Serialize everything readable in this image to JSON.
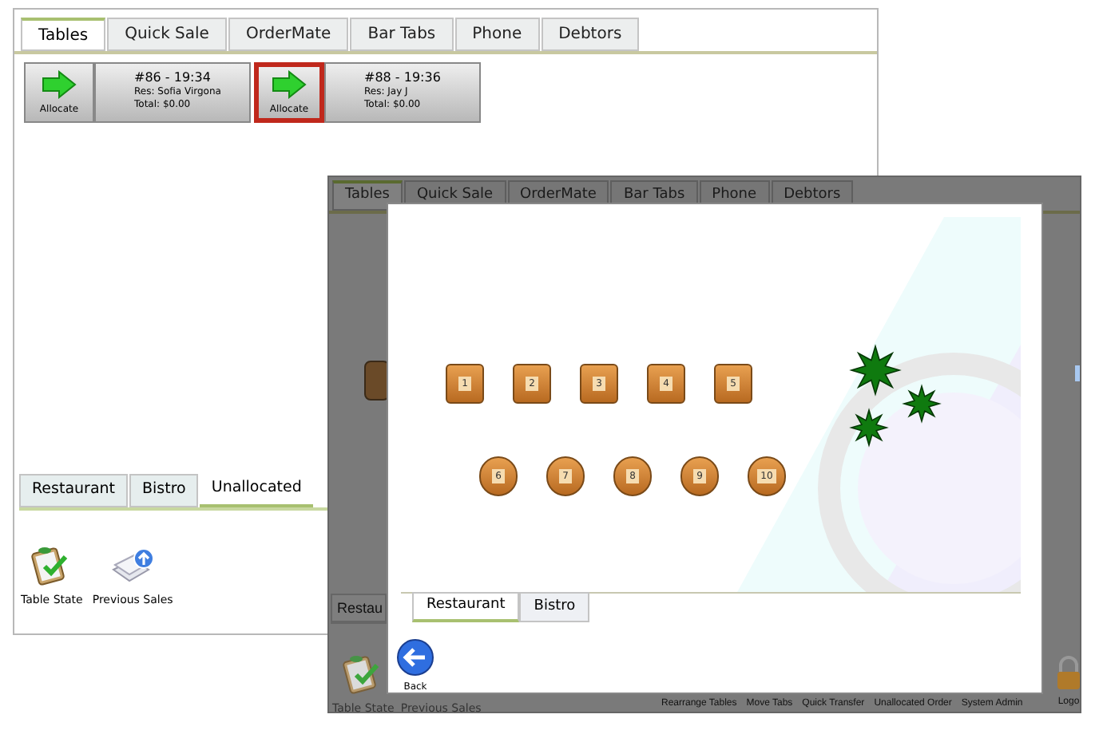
{
  "back_window": {
    "tabs": [
      {
        "label": "Tables",
        "selected": true
      },
      {
        "label": "Quick Sale",
        "selected": false
      },
      {
        "label": "OrderMate",
        "selected": false
      },
      {
        "label": "Bar Tabs",
        "selected": false
      },
      {
        "label": "Phone",
        "selected": false
      },
      {
        "label": "Debtors",
        "selected": false
      }
    ],
    "orders": [
      {
        "allocate_label": "Allocate",
        "title": "#86 - 19:34",
        "reservation": "Res: Sofia Virgona",
        "total": "Total: $0.00",
        "highlighted": false
      },
      {
        "allocate_label": "Allocate",
        "title": "#88 - 19:36",
        "reservation": "Res: Jay J",
        "total": "Total: $0.00",
        "highlighted": true
      }
    ],
    "area_tabs": [
      {
        "label": "Restaurant",
        "selected": false
      },
      {
        "label": "Bistro",
        "selected": false
      },
      {
        "label": "Unallocated",
        "selected": true
      }
    ],
    "toolbar": [
      {
        "label": "Table State",
        "kind": "table-state"
      },
      {
        "label": "Previous Sales",
        "kind": "previous-sales"
      }
    ]
  },
  "front_window": {
    "tabs": [
      {
        "label": "Tables",
        "selected": true
      },
      {
        "label": "Quick Sale",
        "selected": false
      },
      {
        "label": "OrderMate",
        "selected": false
      },
      {
        "label": "Bar Tabs",
        "selected": false
      },
      {
        "label": "Phone",
        "selected": false
      },
      {
        "label": "Debtors",
        "selected": false
      }
    ],
    "area_tab": "Restau",
    "toolbar_left": [
      {
        "label": "Table State",
        "kind": "table-state"
      },
      {
        "label": "Previous Sales",
        "kind": "previous-sales"
      }
    ],
    "toolbar_right": [
      "Rearrange Tables",
      "Move Tabs",
      "Quick Transfer",
      "Unallocated Order",
      "System Admin"
    ],
    "logout_label": "Logo",
    "dialog": {
      "tables": [
        {
          "label": "1",
          "kind": "square"
        },
        {
          "label": "2",
          "kind": "square"
        },
        {
          "label": "3",
          "kind": "square"
        },
        {
          "label": "4",
          "kind": "square"
        },
        {
          "label": "5",
          "kind": "square"
        },
        {
          "label": "6",
          "kind": "round"
        },
        {
          "label": "7",
          "kind": "round"
        },
        {
          "label": "8",
          "kind": "round"
        },
        {
          "label": "9",
          "kind": "round"
        },
        {
          "label": "10",
          "kind": "round"
        }
      ],
      "area_tabs": [
        {
          "label": "Restaurant",
          "selected": true
        },
        {
          "label": "Bistro",
          "selected": false
        }
      ],
      "back_label": "Back"
    }
  }
}
